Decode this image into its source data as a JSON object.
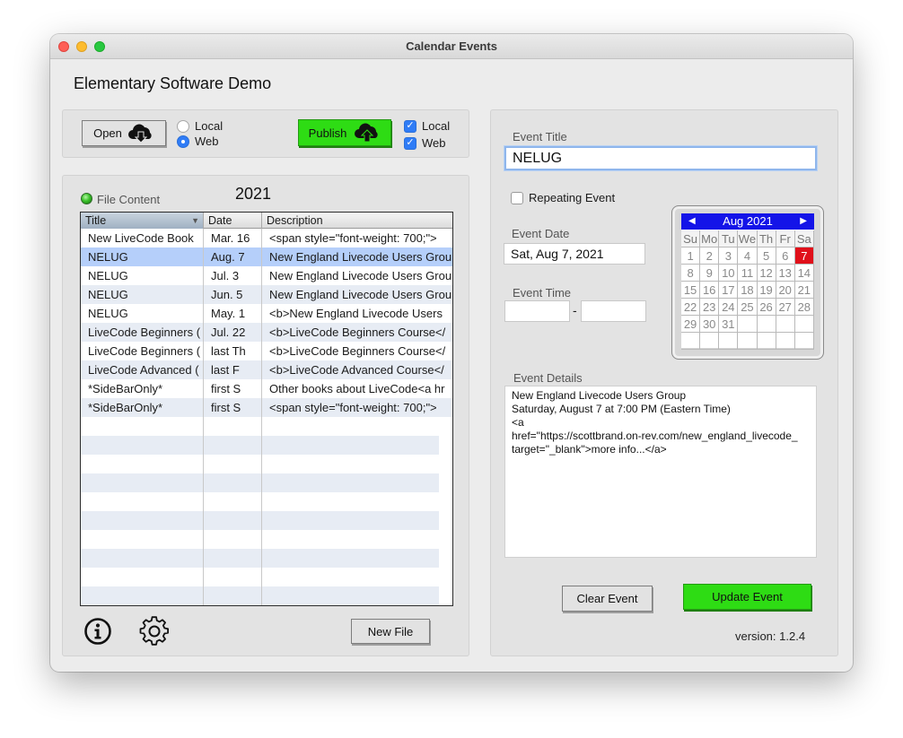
{
  "window": {
    "title": "Calendar Events"
  },
  "app": {
    "heading": "Elementary Software Demo"
  },
  "toolbar": {
    "open_label": "Open",
    "open_source": {
      "local_label": "Local",
      "web_label": "Web",
      "selected": "Web"
    },
    "publish_label": "Publish",
    "publish_targets": {
      "local_label": "Local",
      "local_checked": true,
      "web_label": "Web",
      "web_checked": true
    }
  },
  "file_panel": {
    "status_label": "File Content",
    "year": "2021",
    "columns": [
      "Title",
      "Date",
      "Description"
    ],
    "rows": [
      {
        "title": "New LiveCode Book",
        "date": "Mar. 16",
        "description": "<span style=\"font-weight: 700;\">"
      },
      {
        "title": "NELUG",
        "date": "Aug. 7",
        "description": "New England Livecode Users Grou"
      },
      {
        "title": "NELUG",
        "date": "Jul. 3",
        "description": "New England Livecode Users Grou"
      },
      {
        "title": "NELUG",
        "date": "Jun. 5",
        "description": "New England Livecode Users Grou"
      },
      {
        "title": "NELUG",
        "date": "May. 1",
        "description": "<b>New England Livecode Users"
      },
      {
        "title": "LiveCode Beginners (",
        "date": "Jul. 22",
        "description": "<b>LiveCode Beginners Course</"
      },
      {
        "title": "LiveCode Beginners (",
        "date": "last Th",
        "description": "<b>LiveCode Beginners Course</"
      },
      {
        "title": "LiveCode Advanced (",
        "date": "last F",
        "description": "<b>LiveCode Advanced Course</"
      },
      {
        "title": "*SideBarOnly*",
        "date": "first S",
        "description": "Other books about LiveCode<a hr"
      },
      {
        "title": "*SideBarOnly*",
        "date": "first S",
        "description": "<span style=\"font-weight: 700;\">"
      }
    ],
    "selected_row": 1,
    "new_file_label": "New File"
  },
  "event_form": {
    "title_label": "Event Title",
    "title_value": "NELUG",
    "repeating_label": "Repeating Event",
    "repeating_checked": false,
    "date_label": "Event Date",
    "date_value": "Sat, Aug 7, 2021",
    "time_label": "Event Time",
    "time_start": "",
    "time_end": "",
    "time_separator": "-",
    "details_label": "Event Details",
    "details_value": "New England Livecode Users Group\nSaturday, August 7 at 7:00 PM (Eastern Time)\n<a\nhref=\"https://scottbrand.on-rev.com/new_england_livecode_\ntarget=\"_blank\">more info...</a>",
    "clear_label": "Clear Event",
    "update_label": "Update Event",
    "version": "version: 1.2.4"
  },
  "calendar": {
    "month_label": "Aug 2021",
    "weekdays": [
      "Su",
      "Mo",
      "Tu",
      "We",
      "Th",
      "Fr",
      "Sa"
    ],
    "days": [
      1,
      2,
      3,
      4,
      5,
      6,
      7,
      8,
      9,
      10,
      11,
      12,
      13,
      14,
      15,
      16,
      17,
      18,
      19,
      20,
      21,
      22,
      23,
      24,
      25,
      26,
      27,
      28,
      29,
      30,
      31
    ],
    "first_weekday_index": 0,
    "selected_day": 7,
    "header_color": "#1414e8",
    "selected_color": "#e0101a"
  },
  "colors": {
    "green_button": "#2edc14",
    "selection": "#b5cffa",
    "alt_row": "#e7ecf4",
    "checkbox_blue": "#2f7cf6"
  },
  "icons": {
    "open": "cloud-download-icon",
    "publish": "cloud-upload-icon",
    "info": "info-icon",
    "settings": "gear-icon"
  }
}
